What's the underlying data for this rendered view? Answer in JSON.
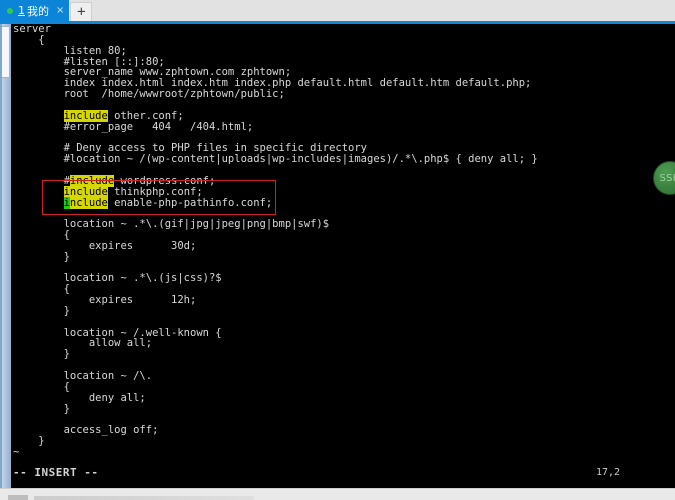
{
  "window": {
    "accent_blue": "#0c84d8",
    "terminal_bg": "#000000",
    "highlight_yellow": "#d7d700",
    "cursor_green": "#18d018",
    "annotation_red": "#cc2222"
  },
  "tabbar": {
    "tabs": [
      {
        "index": "1",
        "title": "我的",
        "close_label": "×",
        "status_dot": "connected"
      }
    ],
    "new_tab_label": "+"
  },
  "editor": {
    "lines": [
      {
        "text": "server",
        "indent": 0
      },
      {
        "text": "    {",
        "indent": 0
      },
      {
        "text": "        listen 80;",
        "indent": 0
      },
      {
        "text": "        #listen [::]:80;",
        "indent": 0
      },
      {
        "text": "        server_name www.zphtown.com zphtown;",
        "indent": 0
      },
      {
        "text": "        index index.html index.htm index.php default.html default.htm default.php;",
        "indent": 0
      },
      {
        "text": "        root  /home/wwwroot/zphtown/public;",
        "indent": 0
      },
      {
        "text": "",
        "indent": 0
      },
      {
        "text": "        include other.conf;",
        "indent": 0,
        "highlight": "include"
      },
      {
        "text": "        #error_page   404   /404.html;",
        "indent": 0
      },
      {
        "text": "",
        "indent": 0
      },
      {
        "text": "        # Deny access to PHP files in specific directory",
        "indent": 0
      },
      {
        "text": "        #location ~ /(wp-content|uploads|wp-includes|images)/.*\\.php$ { deny all; }",
        "indent": 0
      },
      {
        "text": "",
        "indent": 0
      },
      {
        "text": "        #include wordpress.conf;",
        "indent": 0,
        "highlight": "include"
      },
      {
        "text": "        include thinkphp.conf;",
        "indent": 0,
        "highlight": "include"
      },
      {
        "text": "        include enable-php-pathinfo.conf;",
        "indent": 0,
        "highlight": "include-cursor"
      },
      {
        "text": "",
        "indent": 0
      },
      {
        "text": "        location ~ .*\\.(gif|jpg|jpeg|png|bmp|swf)$",
        "indent": 0
      },
      {
        "text": "        {",
        "indent": 0
      },
      {
        "text": "            expires      30d;",
        "indent": 0
      },
      {
        "text": "        }",
        "indent": 0
      },
      {
        "text": "",
        "indent": 0
      },
      {
        "text": "        location ~ .*\\.(js|css)?$",
        "indent": 0
      },
      {
        "text": "        {",
        "indent": 0
      },
      {
        "text": "            expires      12h;",
        "indent": 0
      },
      {
        "text": "        }",
        "indent": 0
      },
      {
        "text": "",
        "indent": 0
      },
      {
        "text": "        location ~ /.well-known {",
        "indent": 0
      },
      {
        "text": "            allow all;",
        "indent": 0
      },
      {
        "text": "        }",
        "indent": 0
      },
      {
        "text": "",
        "indent": 0
      },
      {
        "text": "        location ~ /\\.",
        "indent": 0
      },
      {
        "text": "        {",
        "indent": 0
      },
      {
        "text": "            deny all;",
        "indent": 0
      },
      {
        "text": "        }",
        "indent": 0
      },
      {
        "text": "",
        "indent": 0
      },
      {
        "text": "        access_log off;",
        "indent": 0
      },
      {
        "text": "    }",
        "indent": 0
      },
      {
        "text": "~",
        "indent": 0
      }
    ]
  },
  "statusline": {
    "mode": "-- INSERT --",
    "position": "17,2"
  },
  "overlays": {
    "ssh_badge_label": "SSH",
    "annotation_note": "red-rectangle-around-include-lines"
  }
}
